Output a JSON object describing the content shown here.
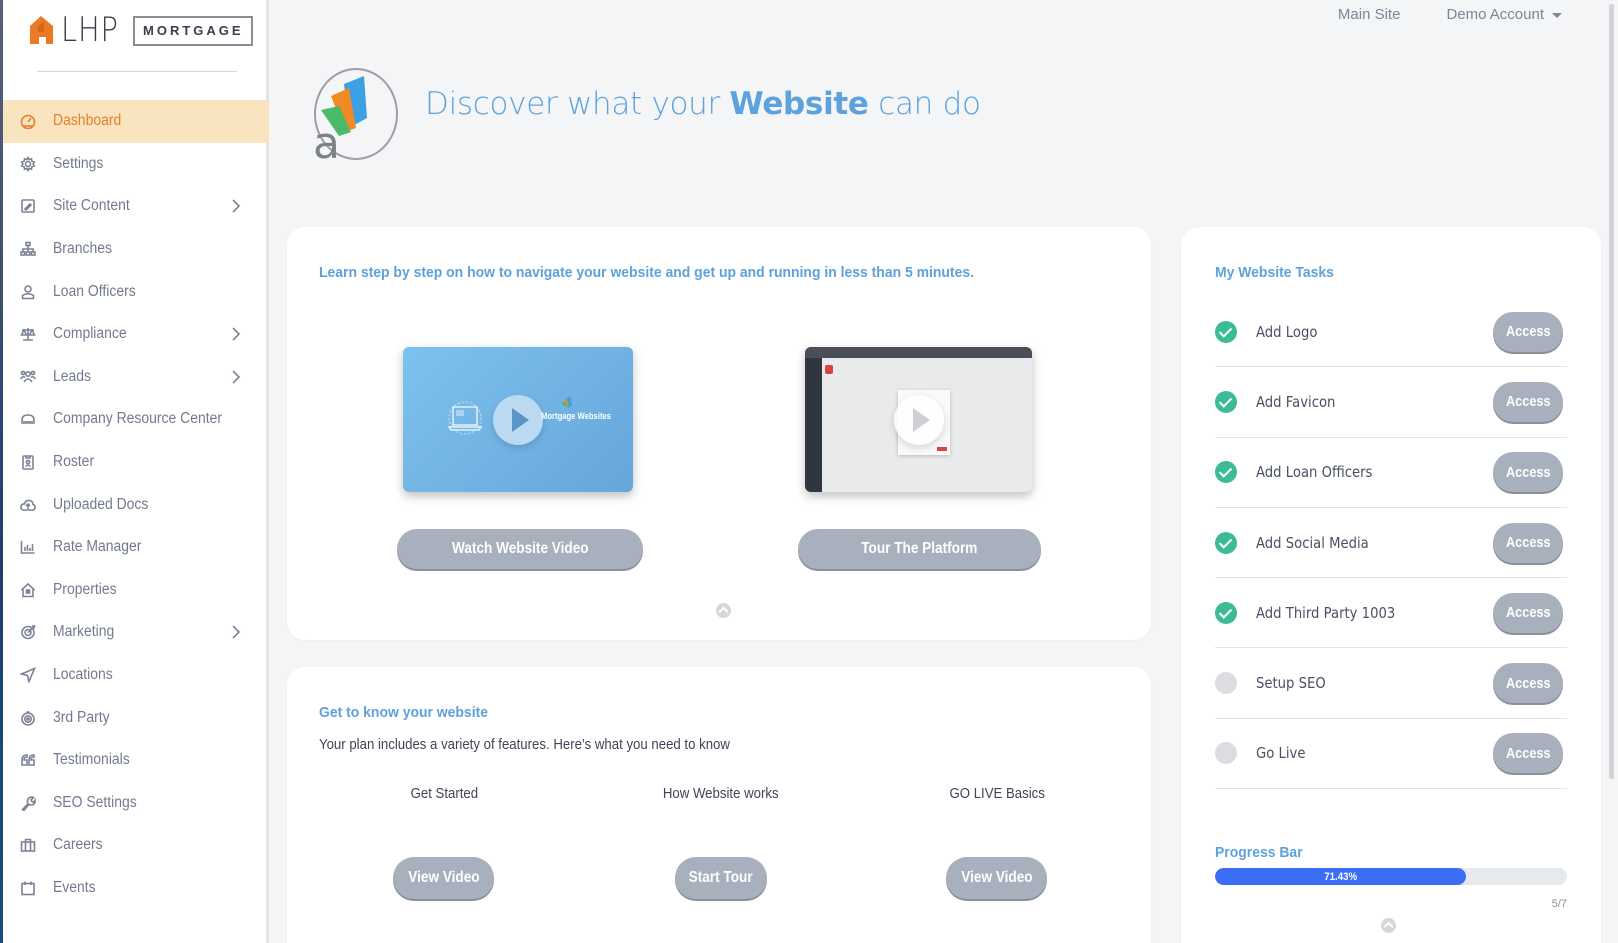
{
  "brand": {
    "logo_text": "LHP",
    "logo_tag": "MORTGAGE",
    "accent_color": "#e97c2c",
    "primary_blue": "#5da2dc"
  },
  "topbar": {
    "main_site": "Main Site",
    "account": "Demo Account"
  },
  "sidebar": {
    "items": [
      {
        "label": "Dashboard",
        "icon": "dashboard-gauge-icon",
        "active": true,
        "has_children": false
      },
      {
        "label": "Settings",
        "icon": "gear-icon",
        "active": false,
        "has_children": false
      },
      {
        "label": "Site Content",
        "icon": "edit-square-icon",
        "active": false,
        "has_children": true
      },
      {
        "label": "Branches",
        "icon": "sitemap-icon",
        "active": false,
        "has_children": false
      },
      {
        "label": "Loan Officers",
        "icon": "user-icon",
        "active": false,
        "has_children": false
      },
      {
        "label": "Compliance",
        "icon": "scales-icon",
        "active": false,
        "has_children": true
      },
      {
        "label": "Leads",
        "icon": "users-group-icon",
        "active": false,
        "has_children": true
      },
      {
        "label": "Company Resource Center",
        "icon": "cloud-storage-icon",
        "active": false,
        "has_children": false
      },
      {
        "label": "Roster",
        "icon": "id-badge-icon",
        "active": false,
        "has_children": false
      },
      {
        "label": "Uploaded Docs",
        "icon": "cloud-upload-icon",
        "active": false,
        "has_children": false
      },
      {
        "label": "Rate Manager",
        "icon": "bar-chart-icon",
        "active": false,
        "has_children": false
      },
      {
        "label": "Properties",
        "icon": "house-icon",
        "active": false,
        "has_children": false
      },
      {
        "label": "Marketing",
        "icon": "target-icon",
        "active": false,
        "has_children": true
      },
      {
        "label": "Locations",
        "icon": "location-arrow-icon",
        "active": false,
        "has_children": false
      },
      {
        "label": "3rd Party",
        "icon": "bullseye-icon",
        "active": false,
        "has_children": false
      },
      {
        "label": "Testimonials",
        "icon": "quote-icon",
        "active": false,
        "has_children": false
      },
      {
        "label": "SEO Settings",
        "icon": "wrench-icon",
        "active": false,
        "has_children": false
      },
      {
        "label": "Careers",
        "icon": "briefcase-icon",
        "active": false,
        "has_children": false
      },
      {
        "label": "Events",
        "icon": "calendar-icon",
        "active": false,
        "has_children": false
      }
    ]
  },
  "hero": {
    "title_pre": "Discover what your ",
    "title_bold": "Website",
    "title_post": " can do"
  },
  "learn": {
    "heading_bold": "Learn step by step",
    "heading_rest": " on how to navigate your website and get up and running in less than 5 minutes.",
    "video_thumb_label": "Mortgage Websites",
    "watch_button": "Watch Website Video",
    "tour_button": "Tour The Platform"
  },
  "know": {
    "heading": "Get to know your website",
    "subtitle": "Your plan includes a variety of features. Here’s what you need to know",
    "features": [
      {
        "title": "Get Started",
        "button": "View Video"
      },
      {
        "title": "How Website works",
        "button": "Start Tour"
      },
      {
        "title": "GO LIVE Basics",
        "button": "View Video"
      }
    ]
  },
  "tasks": {
    "heading": "My Website Tasks",
    "access_label": "Access",
    "items": [
      {
        "label": "Add Logo",
        "done": true
      },
      {
        "label": "Add Favicon",
        "done": true
      },
      {
        "label": "Add Loan Officers",
        "done": true
      },
      {
        "label": "Add Social Media",
        "done": true
      },
      {
        "label": "Add Third Party 1003",
        "done": true
      },
      {
        "label": "Setup SEO",
        "done": false
      },
      {
        "label": "Go Live",
        "done": false
      }
    ],
    "progress": {
      "heading": "Progress Bar",
      "percent": 71.43,
      "percent_label": "71.43%",
      "count_label": "5/7"
    }
  }
}
